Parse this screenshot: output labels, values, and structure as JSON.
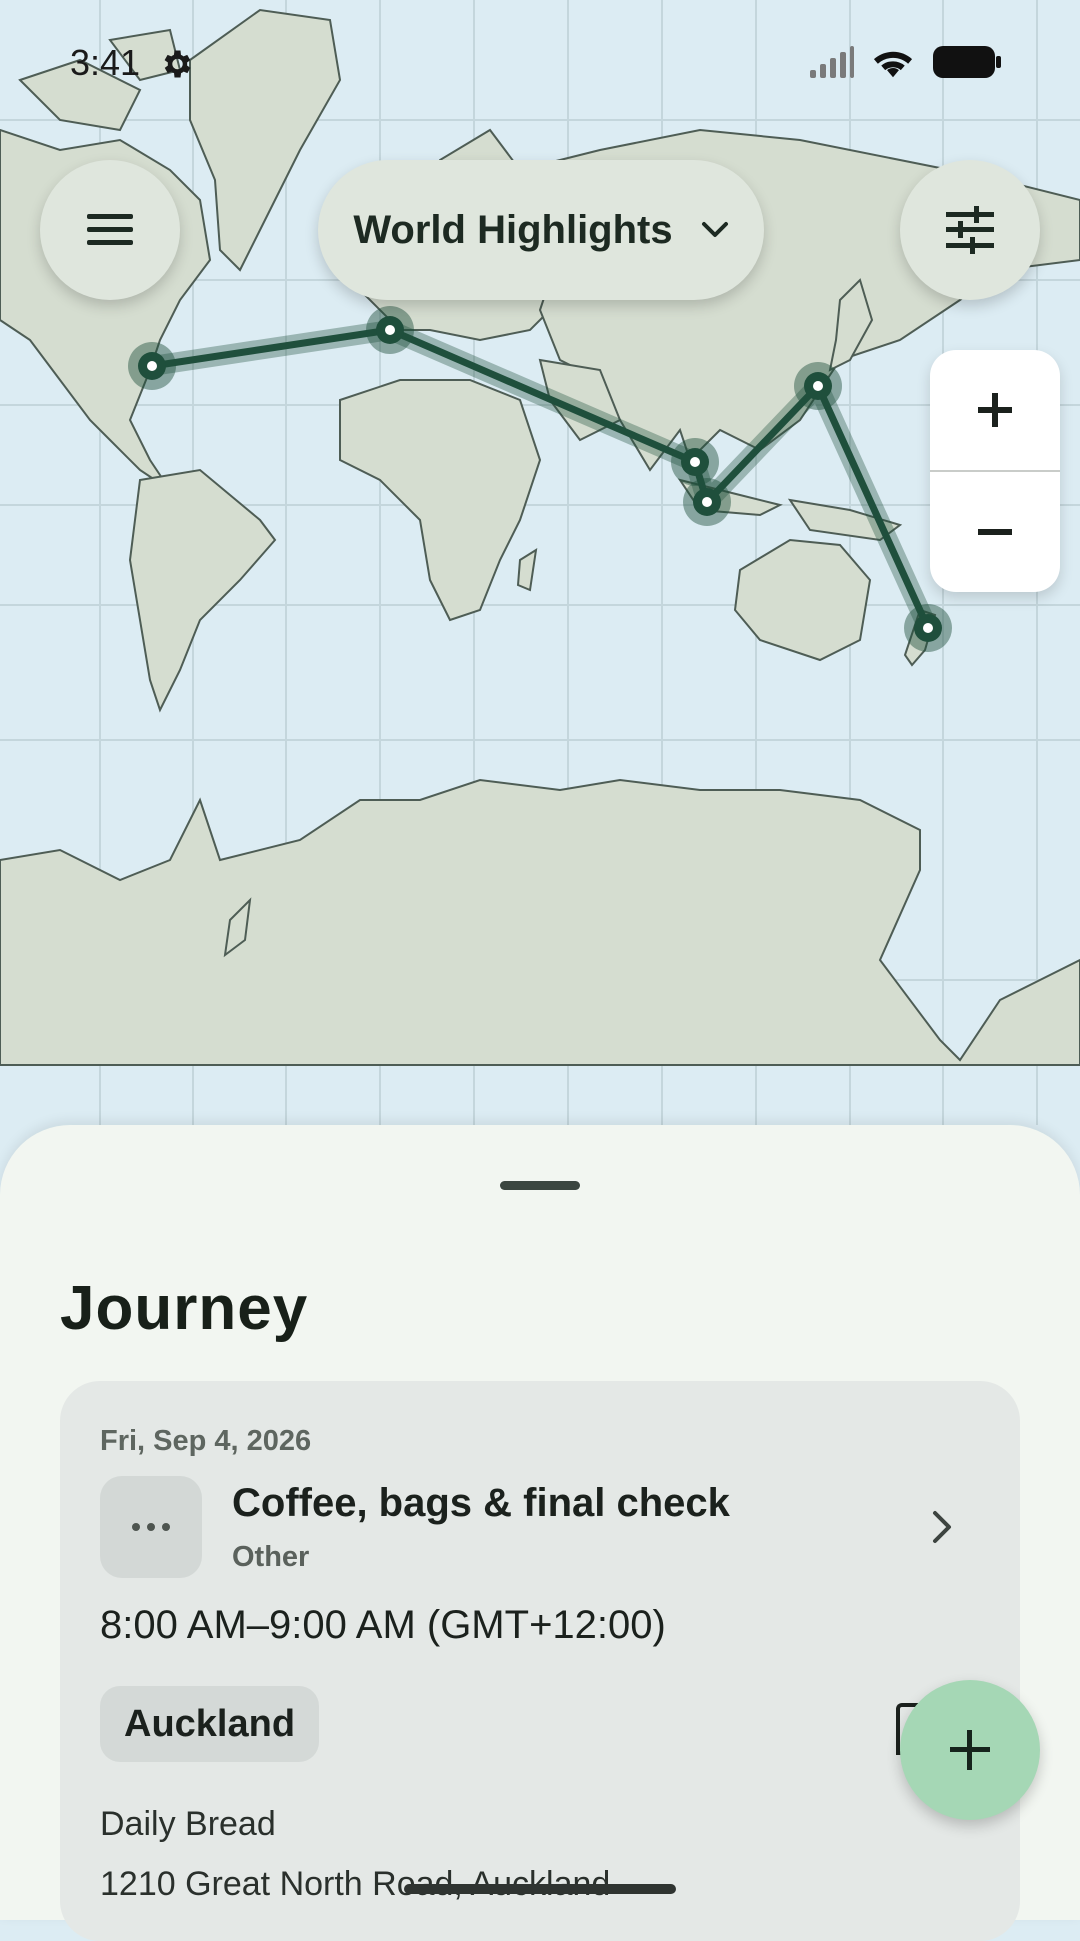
{
  "status_bar": {
    "time": "3:41"
  },
  "map": {
    "selector_label": "World Highlights",
    "zoom_in_label": "+",
    "zoom_out_label": "−",
    "route_color": "#1f4f3c"
  },
  "sheet": {
    "heading": "Journey",
    "event": {
      "date": "Fri, Sep 4, 2026",
      "title": "Coffee, bags & final check",
      "category": "Other",
      "time_range": "8:00 AM–9:00 AM (GMT+12:00)",
      "city_chip": "Auckland",
      "place_name": "Daily Bread",
      "address": "1210 Great North Road, Auckland"
    }
  },
  "colors": {
    "accent": "#1f4f3c",
    "fab": "#a5d7b5",
    "land": "#d5ddd0",
    "water": "#dcecf3"
  },
  "icons": [
    "settings-icon",
    "signal-icon",
    "wifi-icon",
    "battery-icon",
    "menu-icon",
    "chevron-down-icon",
    "tune-icon",
    "plus-icon",
    "minus-icon",
    "more-icon",
    "chevron-right-icon",
    "add-icon"
  ]
}
